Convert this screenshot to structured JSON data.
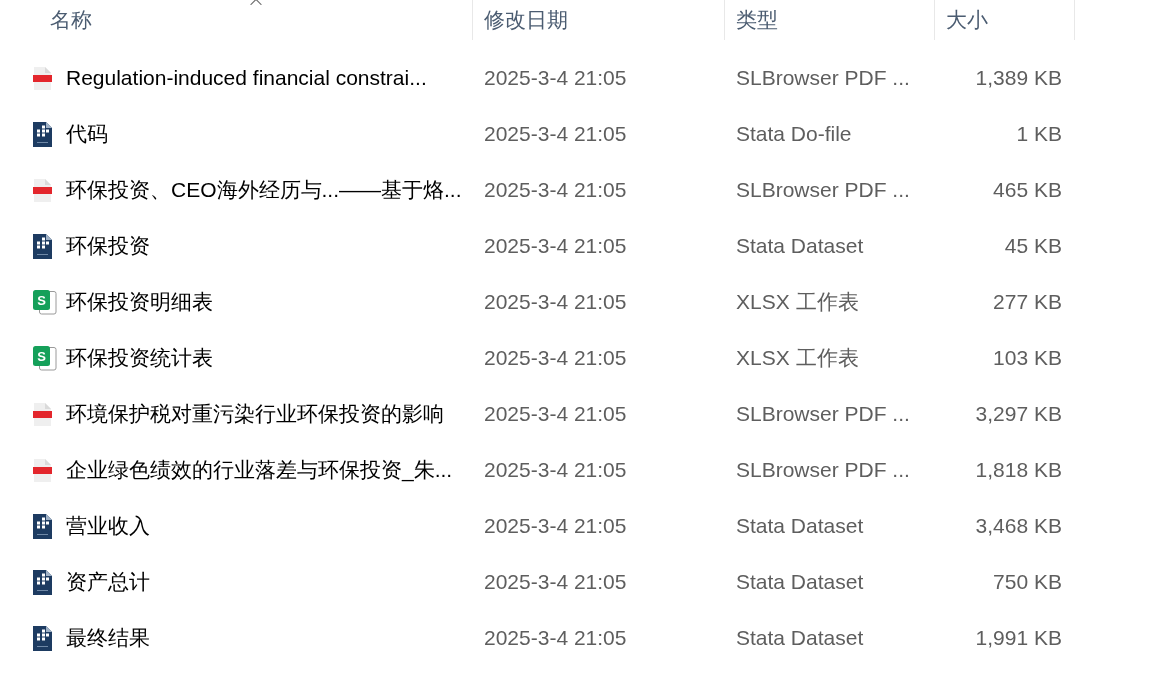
{
  "table": {
    "columns": [
      {
        "label": "名称",
        "sorted": true
      },
      {
        "label": "修改日期",
        "sorted": false
      },
      {
        "label": "类型",
        "sorted": false
      },
      {
        "label": "大小",
        "sorted": false
      }
    ],
    "rows": [
      {
        "kind": "pdf",
        "name": "Regulation-induced financial constrai...",
        "modified": "2025-3-4 21:05",
        "type": "SLBrowser PDF ...",
        "size": "1,389 KB"
      },
      {
        "kind": "stata",
        "name": "代码",
        "modified": "2025-3-4 21:05",
        "type": "Stata Do-file",
        "size": "1 KB"
      },
      {
        "kind": "pdf",
        "name": "环保投资、CEO海外经历与...——基于烙...",
        "modified": "2025-3-4 21:05",
        "type": "SLBrowser PDF ...",
        "size": "465 KB"
      },
      {
        "kind": "stata",
        "name": "环保投资",
        "modified": "2025-3-4 21:05",
        "type": "Stata Dataset",
        "size": "45 KB"
      },
      {
        "kind": "sheet",
        "icon_text": "S",
        "name": "环保投资明细表",
        "modified": "2025-3-4 21:05",
        "type": "XLSX 工作表",
        "size": "277 KB"
      },
      {
        "kind": "sheet",
        "icon_text": "S",
        "name": "环保投资统计表",
        "modified": "2025-3-4 21:05",
        "type": "XLSX 工作表",
        "size": "103 KB"
      },
      {
        "kind": "pdf",
        "name": "环境保护税对重污染行业环保投资的影响",
        "modified": "2025-3-4 21:05",
        "type": "SLBrowser PDF ...",
        "size": "3,297 KB"
      },
      {
        "kind": "pdf",
        "name": "企业绿色绩效的行业落差与环保投资_朱...",
        "modified": "2025-3-4 21:05",
        "type": "SLBrowser PDF ...",
        "size": "1,818 KB"
      },
      {
        "kind": "stata",
        "name": "营业收入",
        "modified": "2025-3-4 21:05",
        "type": "Stata Dataset",
        "size": "3,468 KB"
      },
      {
        "kind": "stata",
        "name": "资产总计",
        "modified": "2025-3-4 21:05",
        "type": "Stata Dataset",
        "size": "750 KB"
      },
      {
        "kind": "stata",
        "name": "最终结果",
        "modified": "2025-3-4 21:05",
        "type": "Stata Dataset",
        "size": "1,991 KB"
      }
    ]
  }
}
